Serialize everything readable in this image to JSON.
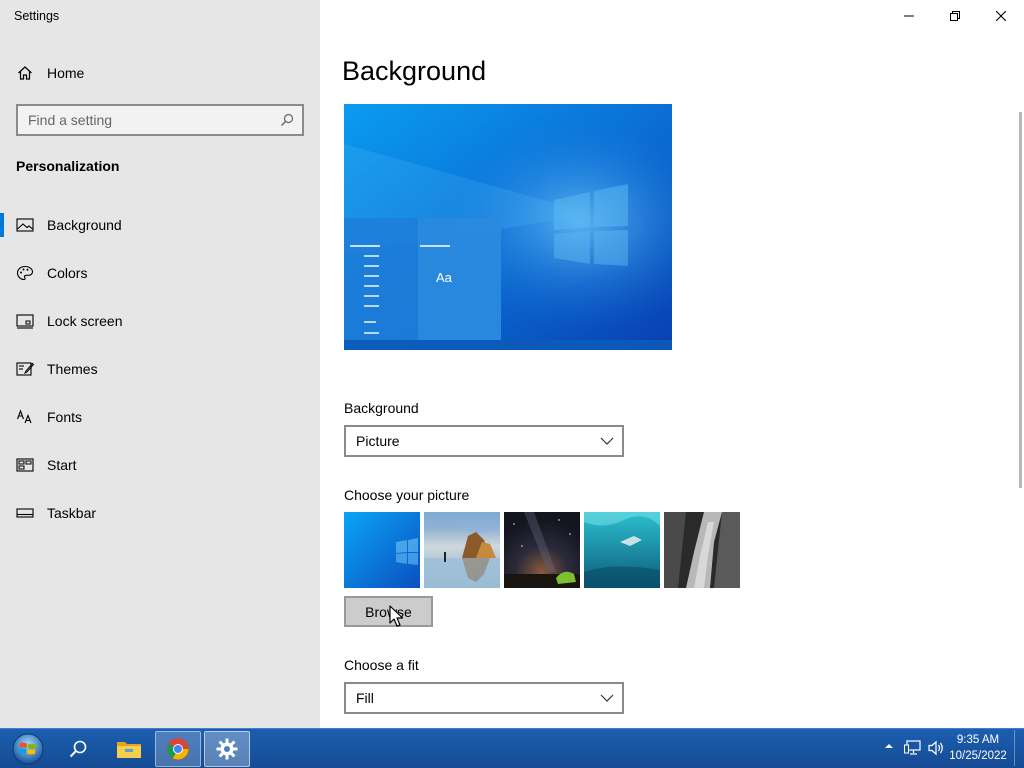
{
  "window": {
    "app_title": "Settings"
  },
  "sidebar": {
    "home_label": "Home",
    "search_placeholder": "Find a setting",
    "section_title": "Personalization",
    "items": [
      {
        "label": "Background",
        "icon": "picture-icon",
        "selected": true
      },
      {
        "label": "Colors",
        "icon": "palette-icon",
        "selected": false
      },
      {
        "label": "Lock screen",
        "icon": "lock-screen-icon",
        "selected": false
      },
      {
        "label": "Themes",
        "icon": "themes-icon",
        "selected": false
      },
      {
        "label": "Fonts",
        "icon": "fonts-icon",
        "selected": false
      },
      {
        "label": "Start",
        "icon": "start-icon",
        "selected": false
      },
      {
        "label": "Taskbar",
        "icon": "taskbar-icon",
        "selected": false
      }
    ]
  },
  "main": {
    "page_title": "Background",
    "preview_sample_text": "Aa",
    "background_label": "Background",
    "background_value": "Picture",
    "choose_picture_label": "Choose your picture",
    "browse_label": "Browse",
    "choose_fit_label": "Choose a fit",
    "fit_value": "Fill"
  },
  "taskbar": {
    "time": "9:35 AM",
    "date": "10/25/2022"
  },
  "colors": {
    "accent": "#0078d7",
    "sidebar_bg": "#e6e6e6",
    "taskbar_bg": "#1a56a2"
  }
}
